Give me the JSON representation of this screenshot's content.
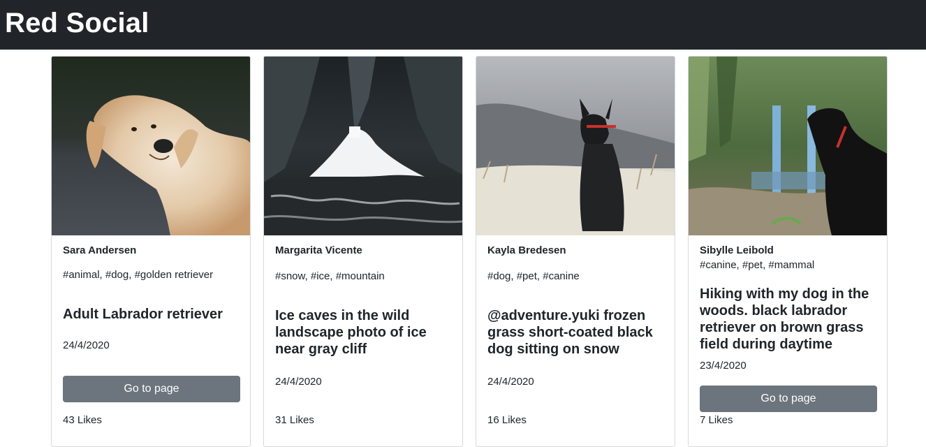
{
  "app": {
    "brand": "Red Social"
  },
  "posts": [
    {
      "author": "Sara Andersen",
      "tags": "#animal, #dog, #golden retriever",
      "title": "Adult Labrador retriever",
      "date": "24/4/2020",
      "button_label": "Go to page",
      "likes": "43 Likes",
      "image": "golden-retriever-photo"
    },
    {
      "author": "Margarita Vicente",
      "tags": "#snow, #ice, #mountain",
      "title": "Ice caves in the wild landscape photo of ice near gray cliff",
      "date": "24/4/2020",
      "likes": "31 Likes",
      "image": "ice-cave-photo"
    },
    {
      "author": "Kayla Bredesen",
      "tags": "#dog, #pet, #canine",
      "title": "@adventure.yuki frozen grass short-coated black dog sitting on snow",
      "date": "24/4/2020",
      "likes": "16 Likes",
      "image": "black-dog-snow-photo"
    },
    {
      "author": "Sibylle Leibold",
      "tags": "#canine, #pet, #mammal",
      "title": "Hiking with my dog in the woods. black labrador retriever on brown grass field during daytime",
      "date": "23/4/2020",
      "button_label": "Go to page",
      "likes": "7 Likes",
      "image": "black-labrador-woods-photo"
    }
  ]
}
